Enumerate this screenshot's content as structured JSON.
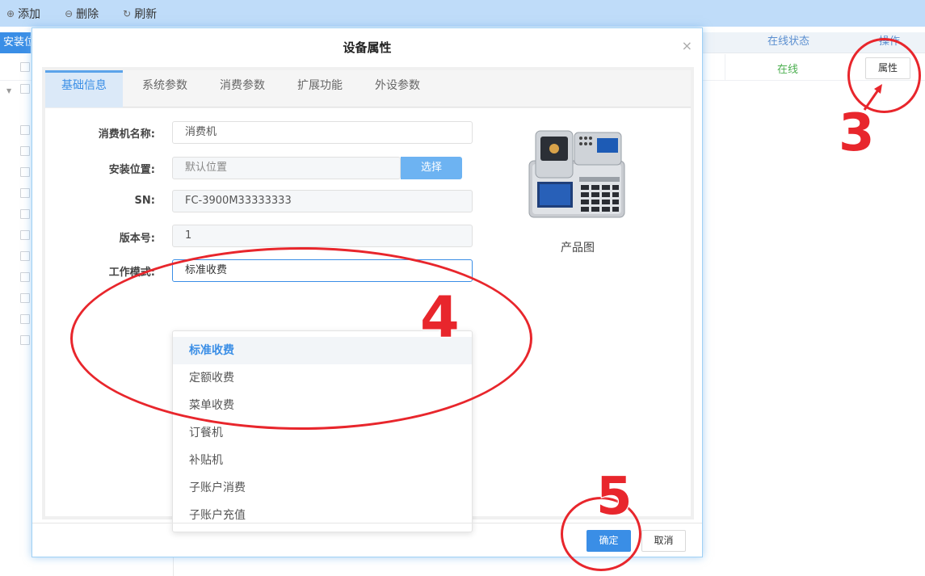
{
  "toolbar": {
    "add_label": "添加",
    "delete_label": "删除",
    "refresh_label": "刷新"
  },
  "table": {
    "first_header": "安装位",
    "status_header": "在线状态",
    "action_header": "操作",
    "row_status": "在线",
    "row_action_label": "属性"
  },
  "modal": {
    "title": "设备属性",
    "close_glyph": "×",
    "tabs": [
      {
        "label": "基础信息"
      },
      {
        "label": "系统参数"
      },
      {
        "label": "消费参数"
      },
      {
        "label": "扩展功能"
      },
      {
        "label": "外设参数"
      }
    ],
    "fields": {
      "name_label": "消费机名称:",
      "name_value": "消费机",
      "location_label": "安装位置:",
      "location_placeholder": "默认位置",
      "location_button": "选择",
      "sn_label": "SN:",
      "sn_value": "FC-3900M33333333",
      "version_label": "版本号:",
      "version_value": "1",
      "mode_label": "工作模式:",
      "mode_value": "标准收费"
    },
    "mode_options": [
      {
        "label": "标准收费"
      },
      {
        "label": "定额收费"
      },
      {
        "label": "菜单收费"
      },
      {
        "label": "订餐机"
      },
      {
        "label": "补贴机"
      },
      {
        "label": "子账户消费"
      },
      {
        "label": "子账户充值"
      }
    ],
    "product_caption": "产品图",
    "ok_label": "确定",
    "cancel_label": "取消"
  },
  "annotations": {
    "step3": "3",
    "step4": "4",
    "step5": "5",
    "color": "#e8262c"
  }
}
